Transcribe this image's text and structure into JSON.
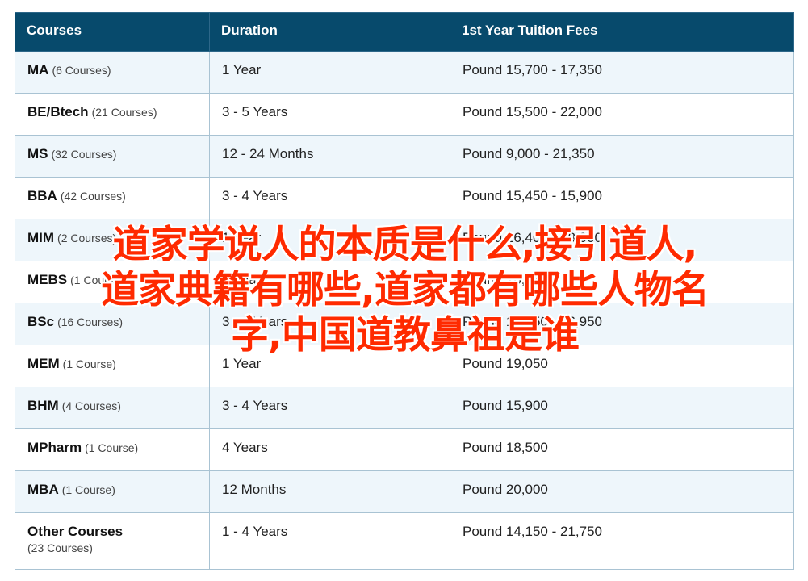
{
  "table": {
    "headers": {
      "courses": "Courses",
      "duration": "Duration",
      "fees": "1st Year Tuition Fees"
    },
    "rows": [
      {
        "name": "MA",
        "count": "(6 Courses)",
        "duration": "1 Year",
        "fees": "Pound 15,700 - 17,350"
      },
      {
        "name": "BE/Btech",
        "count": "(21 Courses)",
        "duration": "3 - 5 Years",
        "fees": "Pound 15,500 - 22,000"
      },
      {
        "name": "MS",
        "count": "(32 Courses)",
        "duration": "12 - 24 Months",
        "fees": "Pound 9,000 - 21,350"
      },
      {
        "name": "BBA",
        "count": "(42 Courses)",
        "duration": "3 - 4 Years",
        "fees": "Pound 15,450 - 15,900"
      },
      {
        "name": "MIM",
        "count": "(2 Courses)",
        "duration": "1 Year",
        "fees": "Pound 16,400 - 18,900"
      },
      {
        "name": "MEBS",
        "count": "(1 Course)",
        "duration": "1 Years",
        "fees": "Pound 26,750"
      },
      {
        "name": "BSc",
        "count": "(16 Courses)",
        "duration": "3 - 4 Years",
        "fees": "Pound 15,950 - 16,950"
      },
      {
        "name": "MEM",
        "count": "(1 Course)",
        "duration": "1 Year",
        "fees": "Pound 19,050"
      },
      {
        "name": "BHM",
        "count": "(4 Courses)",
        "duration": "3 - 4 Years",
        "fees": "Pound 15,900"
      },
      {
        "name": "MPharm",
        "count": "(1 Course)",
        "duration": "4 Years",
        "fees": "Pound 18,500"
      },
      {
        "name": "MBA",
        "count": "(1 Course)",
        "duration": "12 Months",
        "fees": "Pound 20,000"
      },
      {
        "name": "Other Courses",
        "count": "(23 Courses)",
        "duration": "1 - 4 Years",
        "fees": "Pound 14,150 - 21,750"
      }
    ]
  },
  "overlay": {
    "line1": "道家学说人的本质是什么,接引道人,",
    "line2": "道家典籍有哪些,道家都有哪些人物名",
    "line3": "字,中国道教鼻祖是谁"
  },
  "colors": {
    "header_bg": "#074a6c",
    "row_alt_bg": "#eef6fb",
    "overlay_text": "#ff2a00"
  }
}
